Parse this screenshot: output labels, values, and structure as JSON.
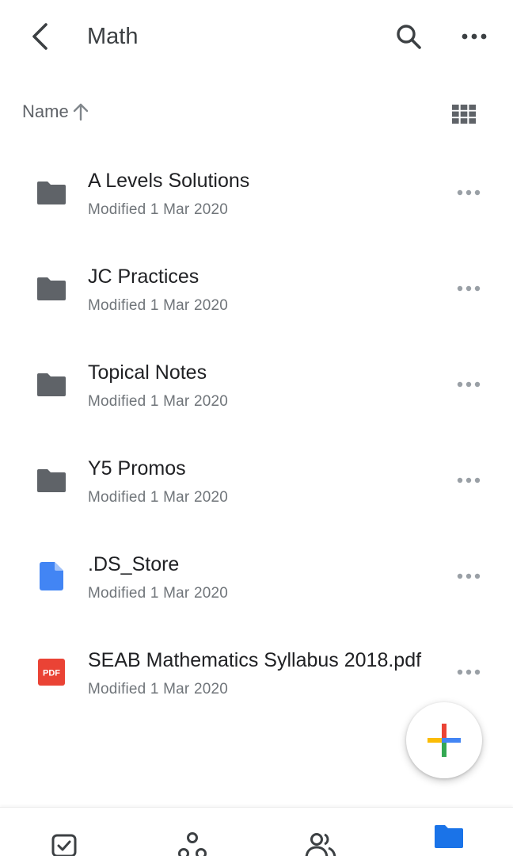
{
  "header": {
    "title": "Math",
    "back_icon": "chevron-left-icon",
    "search_icon": "search-icon",
    "more_icon": "more-horizontal-icon"
  },
  "sort": {
    "label": "Name",
    "direction_icon": "arrow-up-icon",
    "view_toggle_icon": "grid-view-icon"
  },
  "files": [
    {
      "name": "A Levels Solutions",
      "modified": "Modified 1 Mar 2020",
      "type": "folder"
    },
    {
      "name": "JC Practices",
      "modified": "Modified 1 Mar 2020",
      "type": "folder"
    },
    {
      "name": "Topical Notes",
      "modified": "Modified 1 Mar 2020",
      "type": "folder"
    },
    {
      "name": "Y5 Promos",
      "modified": "Modified 1 Mar 2020",
      "type": "folder"
    },
    {
      "name": ".DS_Store",
      "modified": "Modified 1 Mar 2020",
      "type": "file"
    },
    {
      "name": "SEAB Mathematics Syllabus 2018.pdf",
      "modified": "Modified 1 Mar 2020",
      "type": "pdf"
    }
  ],
  "pdf_badge": "PDF",
  "fab": {
    "icon": "plus-icon"
  },
  "bottom_nav": [
    {
      "icon": "priority-icon"
    },
    {
      "icon": "workspaces-icon"
    },
    {
      "icon": "shared-icon"
    },
    {
      "icon": "files-icon",
      "active": true
    }
  ],
  "colors": {
    "folder": "#5f6368",
    "doc": "#4285f4",
    "pdf": "#ea4335",
    "active_nav": "#1a73e8",
    "text_primary": "#202124",
    "text_secondary": "#70757a"
  }
}
